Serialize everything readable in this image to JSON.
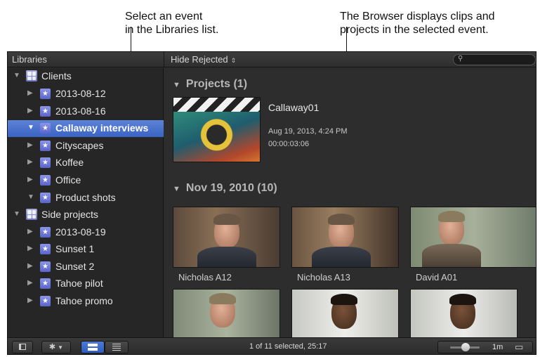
{
  "callouts": {
    "left_line1": "Select an event",
    "left_line2": "in the Libraries list.",
    "right_line1": "The Browser displays clips and",
    "right_line2": "projects in the selected event."
  },
  "toolbar": {
    "libraries_header": "Libraries",
    "hide_rejected": "Hide Rejected",
    "search_placeholder": ""
  },
  "sidebar": {
    "items": [
      {
        "label": "Clients",
        "type": "library",
        "expanded": true
      },
      {
        "label": "2013-08-12",
        "type": "event",
        "expanded": false
      },
      {
        "label": "2013-08-16",
        "type": "event",
        "expanded": false
      },
      {
        "label": "Callaway interviews",
        "type": "event",
        "expanded": true,
        "selected": true
      },
      {
        "label": "Cityscapes",
        "type": "event",
        "expanded": false
      },
      {
        "label": "Koffee",
        "type": "event",
        "expanded": false
      },
      {
        "label": "Office",
        "type": "event",
        "expanded": false
      },
      {
        "label": "Product shots",
        "type": "event",
        "expanded": true
      },
      {
        "label": "Side projects",
        "type": "library",
        "expanded": true
      },
      {
        "label": "2013-08-19",
        "type": "event",
        "expanded": false
      },
      {
        "label": "Sunset 1",
        "type": "event",
        "expanded": false
      },
      {
        "label": "Sunset 2",
        "type": "event",
        "expanded": false
      },
      {
        "label": "Tahoe pilot",
        "type": "event",
        "expanded": false
      },
      {
        "label": "Tahoe promo",
        "type": "event",
        "expanded": false
      }
    ]
  },
  "browser": {
    "projects_header": "Projects  (1)",
    "project": {
      "title": "Callaway01",
      "date": "Aug 19, 2013, 4:24 PM",
      "duration": "00:00:03:06"
    },
    "clips_header": "Nov 19, 2010  (10)",
    "clips": [
      {
        "name": "Nicholas A12"
      },
      {
        "name": "Nicholas A13"
      },
      {
        "name": "David A01"
      },
      {
        "name": ""
      },
      {
        "name": ""
      },
      {
        "name": ""
      }
    ]
  },
  "status": {
    "selection": "1 of 11 selected, 25:17",
    "zoom_label": "1m"
  },
  "icons": {
    "triangle_expanded": "▼",
    "triangle_collapsed": "▶",
    "event_star": "★",
    "gear": "✱",
    "search": "⚲",
    "updown": "⇕"
  },
  "colors": {
    "selection_blue": "#3f66c6",
    "panel_bg": "#262626",
    "browser_bg": "#2d2d2d"
  }
}
